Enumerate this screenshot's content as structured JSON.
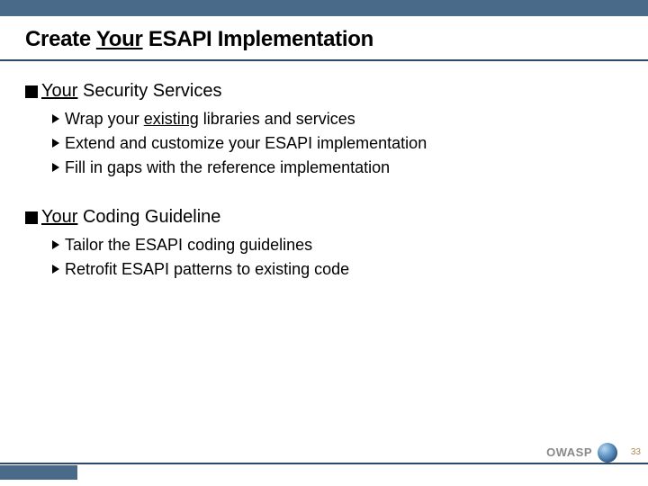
{
  "title": {
    "before": "Create ",
    "underlined": "Your",
    "after": " ESAPI Implementation"
  },
  "sections": [
    {
      "head_underlined": "Your",
      "head_after": " Security Services",
      "bullets": [
        {
          "before": "Wrap your ",
          "underlined": "existing",
          "after": " libraries and services"
        },
        {
          "before": "Extend and customize your ESAPI implementation",
          "underlined": "",
          "after": ""
        },
        {
          "before": "Fill in gaps with the reference implementation",
          "underlined": "",
          "after": ""
        }
      ]
    },
    {
      "head_underlined": "Your",
      "head_after": " Coding Guideline",
      "bullets": [
        {
          "before": "Tailor the ESAPI coding guidelines",
          "underlined": "",
          "after": ""
        },
        {
          "before": "Retrofit ESAPI patterns to existing code",
          "underlined": "",
          "after": ""
        }
      ]
    }
  ],
  "footer": {
    "org": "OWASP",
    "page": "33"
  }
}
